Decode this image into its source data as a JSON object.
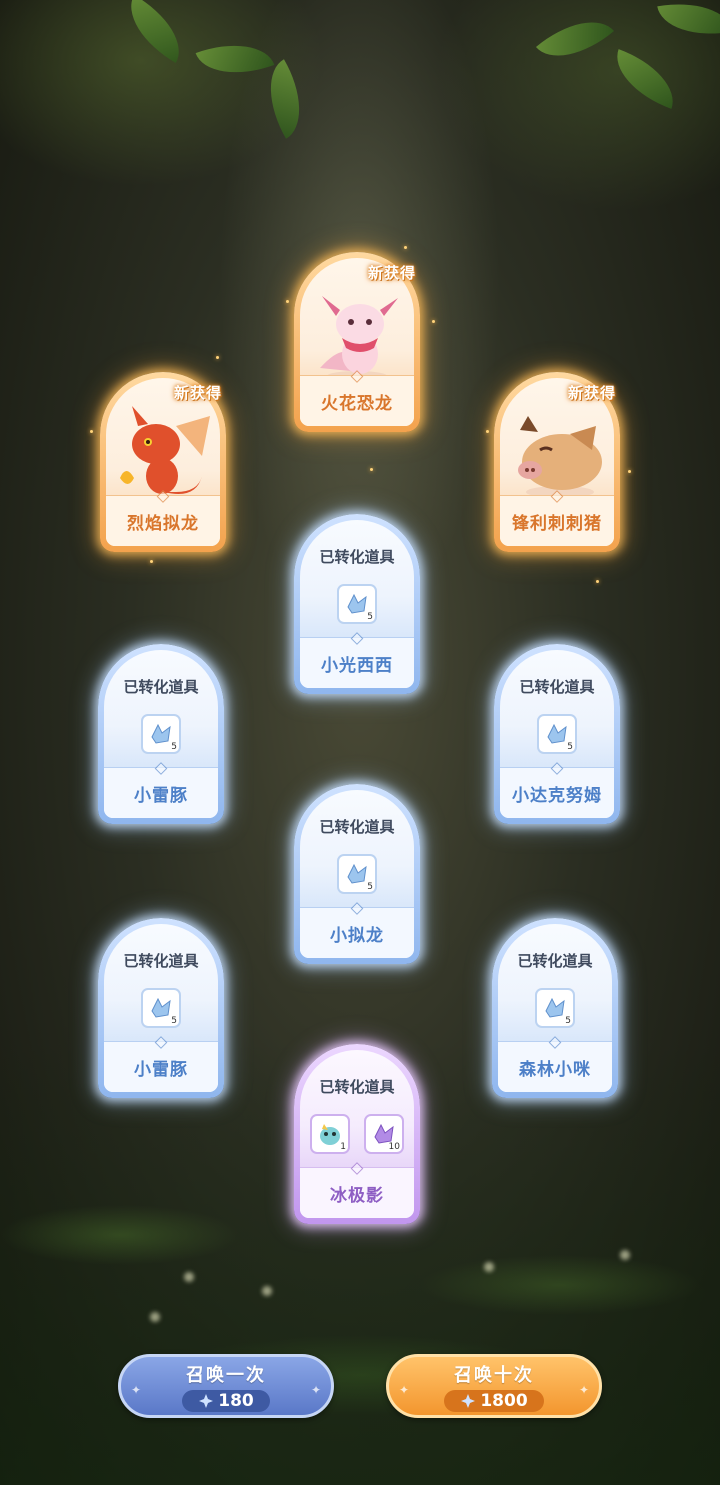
{
  "new_badge": "新获得",
  "converted_label": "已转化道具",
  "cards": {
    "c1": {
      "name": "火花恐龙",
      "rarity": "new"
    },
    "c2": {
      "name": "烈焰拟龙",
      "rarity": "new"
    },
    "c3": {
      "name": "锋利刺刺猪",
      "rarity": "new"
    },
    "c4": {
      "name": "小光西西",
      "rarity": "blue",
      "qty": "5"
    },
    "c5": {
      "name": "小雷豚",
      "rarity": "blue",
      "qty": "5"
    },
    "c6": {
      "name": "小达克努姆",
      "rarity": "blue",
      "qty": "5"
    },
    "c7": {
      "name": "小拟龙",
      "rarity": "blue",
      "qty": "5"
    },
    "c8": {
      "name": "小雷豚",
      "rarity": "blue",
      "qty": "5"
    },
    "c9": {
      "name": "森林小咪",
      "rarity": "blue",
      "qty": "5"
    },
    "c10": {
      "name": "冰极影",
      "rarity": "purple",
      "qty_a": "1",
      "qty_b": "10"
    }
  },
  "buttons": {
    "single": {
      "label": "召唤一次",
      "cost": "180"
    },
    "ten": {
      "label": "召唤十次",
      "cost": "1800"
    }
  },
  "colors": {
    "orange": "#f3a24d",
    "blue": "#8fb6ee",
    "purple": "#c196ee"
  }
}
